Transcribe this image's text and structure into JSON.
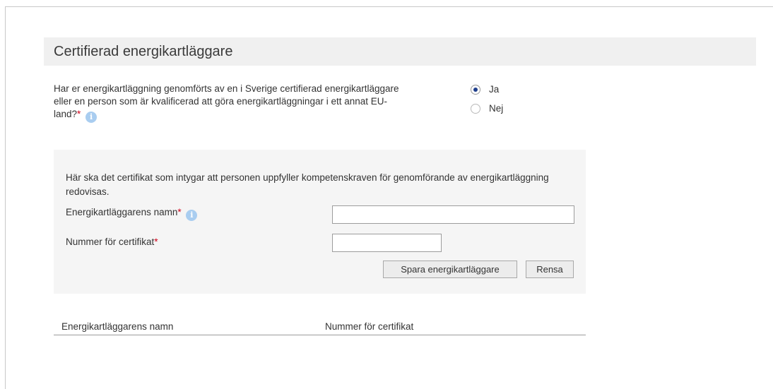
{
  "section": {
    "title": "Certifierad energikartläggare"
  },
  "question": {
    "text": "Har er energikartläggning genomförts av en i Sverige certifierad energikartläggare eller en person som är kvalificerad att göra energikartläggningar i ett annat EU-land?",
    "required_mark": "*",
    "info_icon": "i"
  },
  "options": [
    {
      "label": "Ja",
      "selected": true
    },
    {
      "label": "Nej",
      "selected": false
    }
  ],
  "certificate": {
    "intro": "Här ska det certifikat som intygar att personen uppfyller kompetenskraven för genomförande av energikartläggning redovisas.",
    "name_label": "Energikartläggarens namn",
    "name_required": "*",
    "name_info_icon": "i",
    "name_value": "",
    "number_label": "Nummer för certifikat",
    "number_required": "*",
    "number_value": "",
    "save_button": "Spara energikartläggare",
    "clear_button": "Rensa"
  },
  "table": {
    "columns": [
      "Energikartläggarens namn",
      "Nummer för certifikat"
    ],
    "rows": []
  },
  "colors": {
    "required": "#d0021b",
    "info_icon": "#a9cdf0",
    "radio_selected": "#1f3e8c",
    "header_bg": "#f0f0f0",
    "panel_bg": "#f5f5f5"
  }
}
